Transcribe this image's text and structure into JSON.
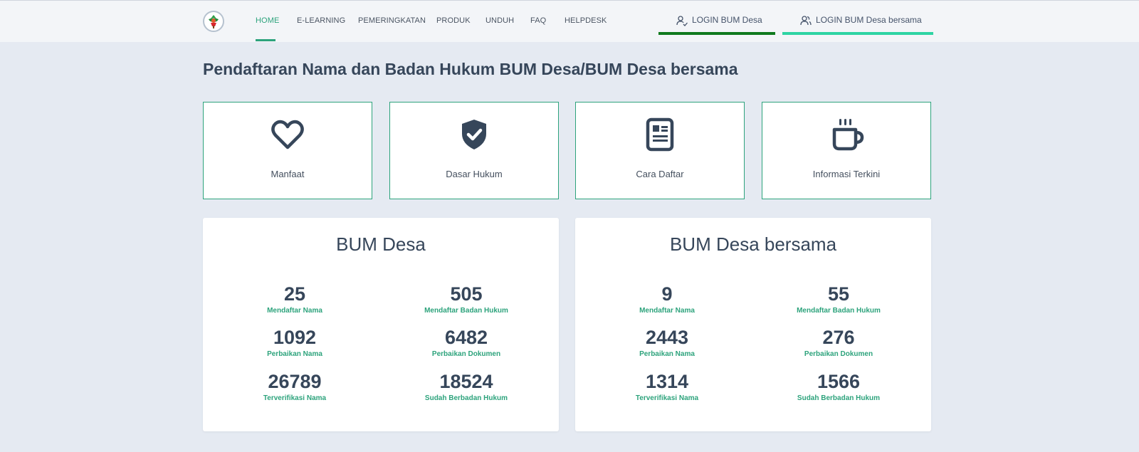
{
  "nav": {
    "items": [
      {
        "label": "HOME",
        "active": true
      },
      {
        "label": "E-LEARNING"
      },
      {
        "label": "PEMERINGKATAN"
      },
      {
        "label": "PRODUK"
      },
      {
        "label": "UNDUH"
      },
      {
        "label": "FAQ"
      },
      {
        "label": "HELPDESK"
      }
    ],
    "login_bum_desa": "LOGIN BUM Desa",
    "login_bum_desa_bersama": "LOGIN BUM Desa bersama"
  },
  "colors": {
    "accent": "#2da37c",
    "login_desa_bar": "#0f7a1e",
    "login_bersama_bar": "#2ed4a3",
    "text_dark": "#36465a"
  },
  "page": {
    "title": "Pendaftaran Nama dan Badan Hukum BUM Desa/BUM Desa bersama"
  },
  "features": [
    {
      "label": "Manfaat",
      "icon": "heart-icon"
    },
    {
      "label": "Dasar Hukum",
      "icon": "shield-check-icon"
    },
    {
      "label": "Cara Daftar",
      "icon": "document-icon"
    },
    {
      "label": "Informasi Terkini",
      "icon": "coffee-cup-icon"
    }
  ],
  "panels": [
    {
      "title": "BUM Desa",
      "stats": [
        {
          "value": "25",
          "label": "Mendaftar Nama"
        },
        {
          "value": "505",
          "label": "Mendaftar Badan Hukum"
        },
        {
          "value": "1092",
          "label": "Perbaikan Nama"
        },
        {
          "value": "6482",
          "label": "Perbaikan Dokumen"
        },
        {
          "value": "26789",
          "label": "Terverifikasi Nama"
        },
        {
          "value": "18524",
          "label": "Sudah Berbadan Hukum"
        }
      ]
    },
    {
      "title": "BUM Desa bersama",
      "stats": [
        {
          "value": "9",
          "label": "Mendaftar Nama"
        },
        {
          "value": "55",
          "label": "Mendaftar Badan Hukum"
        },
        {
          "value": "2443",
          "label": "Perbaikan Nama"
        },
        {
          "value": "276",
          "label": "Perbaikan Dokumen"
        },
        {
          "value": "1314",
          "label": "Terverifikasi Nama"
        },
        {
          "value": "1566",
          "label": "Sudah Berbadan Hukum"
        }
      ]
    }
  ]
}
